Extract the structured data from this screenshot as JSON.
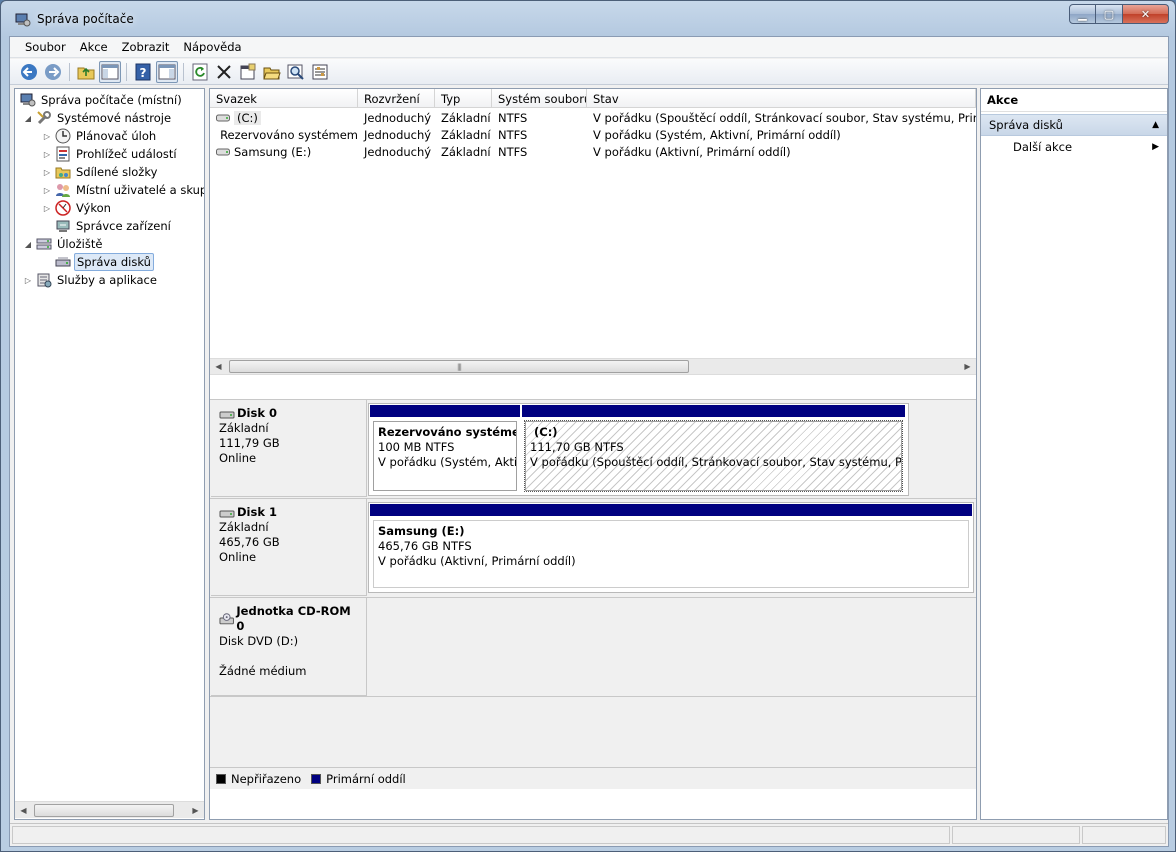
{
  "window": {
    "title": "Správa počítače"
  },
  "menu": [
    "Soubor",
    "Akce",
    "Zobrazit",
    "Nápověda"
  ],
  "toolbar": [
    {
      "icon": "back-arrow-icon"
    },
    {
      "icon": "forward-arrow-icon"
    },
    {
      "icon": "up-folder-icon"
    },
    {
      "icon": "show-hide-tree-icon"
    },
    {
      "icon": "help-icon"
    },
    {
      "icon": "show-hide-action-pane-icon"
    },
    {
      "icon": "refresh-icon"
    },
    {
      "icon": "delete-icon"
    },
    {
      "icon": "properties-icon"
    },
    {
      "icon": "open-icon"
    },
    {
      "icon": "search-icon"
    },
    {
      "icon": "settings-icon"
    }
  ],
  "tree": {
    "root": "Správa počítače (místní)",
    "system_tools": "Systémové nástroje",
    "task_scheduler": "Plánovač úloh",
    "event_viewer": "Prohlížeč událostí",
    "shared_folders": "Sdílené složky",
    "local_users": "Místní uživatelé a skupiny",
    "performance": "Výkon",
    "device_manager": "Správce zařízení",
    "storage": "Úložiště",
    "disk_management": "Správa disků",
    "services": "Služby a aplikace"
  },
  "volumes": {
    "headers": [
      "Svazek",
      "Rozvržení",
      "Typ",
      "Systém souborů",
      "Stav"
    ],
    "rows": [
      [
        "(C:)",
        "Jednoduchý",
        "Základní",
        "NTFS",
        "V pořádku (Spouštěcí oddíl, Stránkovací soubor, Stav systému, Primární oddíl)"
      ],
      [
        "Rezervováno systémem",
        "Jednoduchý",
        "Základní",
        "NTFS",
        "V pořádku (Systém, Aktivní, Primární oddíl)"
      ],
      [
        "Samsung (E:)",
        "Jednoduchý",
        "Základní",
        "NTFS",
        "V pořádku (Aktivní, Primární oddíl)"
      ]
    ]
  },
  "disks": [
    {
      "name": "Disk 0",
      "type": "Základní",
      "size": "111,79 GB",
      "status": "Online",
      "partitions": [
        {
          "name": "Rezervováno systémem",
          "size": "100 MB NTFS",
          "status": "V pořádku (Systém, Aktivní, Primární oddíl)"
        },
        {
          "name": "(C:)",
          "size": "111,70 GB NTFS",
          "status": "V pořádku (Spouštěcí oddíl, Stránkovací soubor, Stav systému, Primární oddíl)"
        }
      ]
    },
    {
      "name": "Disk 1",
      "type": "Základní",
      "size": "465,76 GB",
      "status": "Online",
      "partitions": [
        {
          "name": "Samsung  (E:)",
          "size": "465,76 GB NTFS",
          "status": "V pořádku (Aktivní, Primární oddíl)"
        }
      ]
    },
    {
      "name": "Jednotka CD-ROM 0",
      "type": "Disk DVD (D:)",
      "size": "",
      "status": "Žádné médium"
    }
  ],
  "legend": [
    {
      "label": "Nepřiřazeno",
      "color": "#000000"
    },
    {
      "label": "Primární oddíl",
      "color": "#000080"
    }
  ],
  "actions": {
    "header": "Akce",
    "section": "Správa disků",
    "item": "Další akce"
  },
  "colors": {
    "primary_partition": "#000080",
    "selection": "#dde9f7"
  }
}
